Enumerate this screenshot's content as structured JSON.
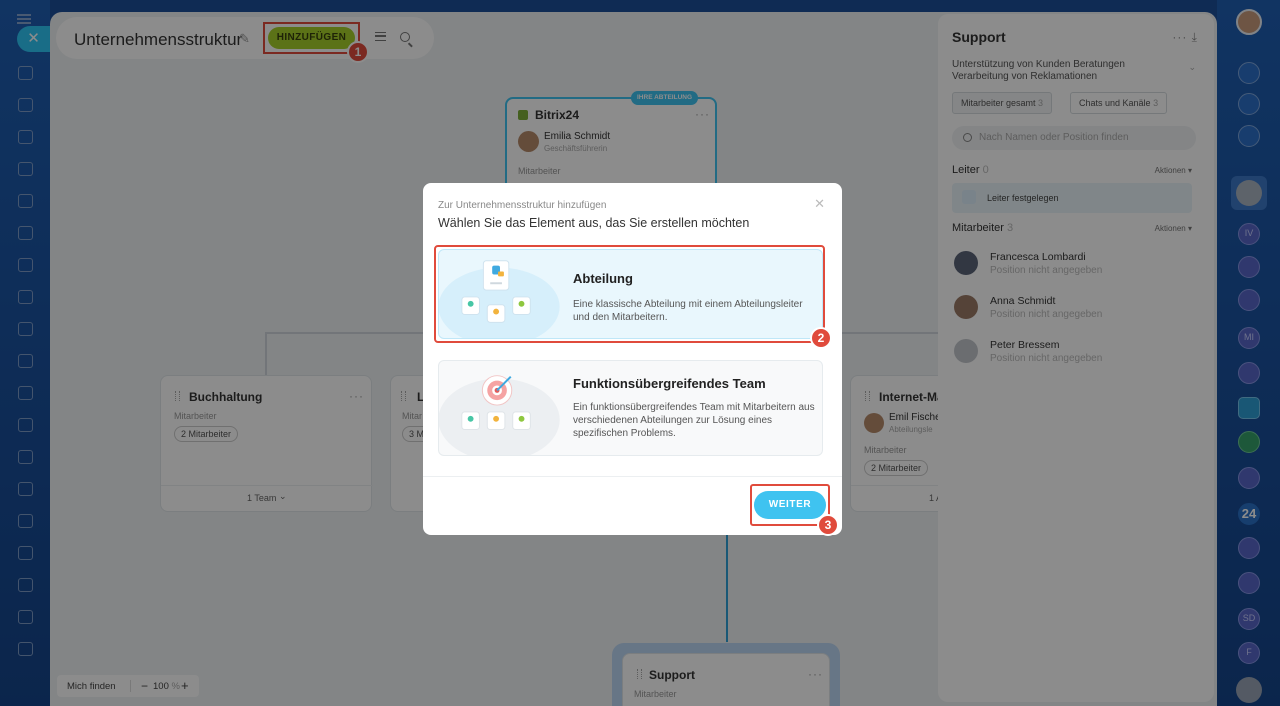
{
  "header": {
    "title": "Unternehmensstruktur",
    "add_label": "HINZUFÜGEN"
  },
  "steps": [
    "1",
    "2",
    "3"
  ],
  "root_card": {
    "badge": "IHRE ABTEILUNG",
    "title": "Bitrix24",
    "head_name": "Emilia Schmidt",
    "head_role": "Geschäftsführerin",
    "members_label": "Mitarbeiter"
  },
  "dept_cards": [
    {
      "title": "Buchhaltung",
      "members_label": "Mitarbeiter",
      "count": "2 Mitarbeiter",
      "footer": "1 Team"
    },
    {
      "title": "L",
      "members_label": "Mitar",
      "count": "3 M"
    },
    {
      "title": "Internet-Ma",
      "head_name": "Emil Fische",
      "head_role": "Abteilungsle",
      "members_label": "Mitarbeiter",
      "count": "2 Mitarbeiter",
      "footer": "1 A"
    },
    {
      "title": "Support",
      "members_label": "Mitarbeiter"
    }
  ],
  "panel": {
    "title": "Support",
    "description": "Unterstützung von Kunden Beratungen Verarbeitung von Reklamationen",
    "tabs": [
      {
        "label": "Mitarbeiter gesamt",
        "count": "3"
      },
      {
        "label": "Chats und Kanäle",
        "count": "3"
      }
    ],
    "search_placeholder": "Nach Namen oder Position finden",
    "leader_label": "Leiter",
    "leader_count": "0",
    "actions_label": "Aktionen",
    "leader_set": "Leiter festgelegen",
    "members_label": "Mitarbeiter",
    "members_count": "3",
    "members": [
      {
        "name": "Francesca Lombardi",
        "position": "Position nicht angegeben"
      },
      {
        "name": "Anna Schmidt",
        "position": "Position nicht angegeben"
      },
      {
        "name": "Peter Bressem",
        "position": "Position nicht angegeben"
      }
    ]
  },
  "modal": {
    "subtitle": "Zur Unternehmensstruktur hinzufügen",
    "title": "Wählen Sie das Element aus, das Sie erstellen möchten",
    "options": [
      {
        "title": "Abteilung",
        "description": "Eine klassische Abteilung mit einem Abteilungsleiter und den Mitarbeitern."
      },
      {
        "title": "Funktionsübergreifendes Team",
        "description": "Ein funktionsübergreifendes Team mit Mitarbeitern aus verschiedenen Abteilungen zur Lösung eines spezifischen Problems."
      }
    ],
    "next_label": "WEITER"
  },
  "zoom": {
    "find_label": "Mich finden",
    "value": "100",
    "unit": "%"
  },
  "right_rail": {
    "badges": [
      "IV",
      "MI",
      "24",
      "SD",
      "F"
    ]
  },
  "colors": {
    "accent": "#3fc3f0",
    "add_button": "#a7d02a",
    "annotation": "#e04b3c",
    "rail": "#1d4f9a"
  }
}
